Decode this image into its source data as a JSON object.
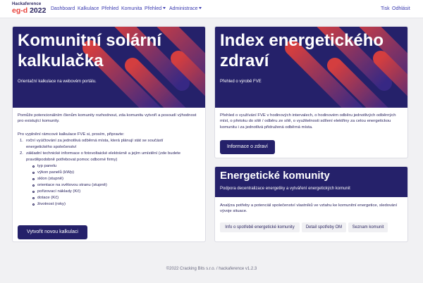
{
  "logo": {
    "line1": "Hackaference",
    "line2_red": "eg-d",
    "line2_dark": " 2022"
  },
  "nav": {
    "dashboard": "Dashboard",
    "kalkulace": "Kalkulace",
    "prehled": "Přehled",
    "komunita": "Komunita",
    "prehled_dropdown": "Přehled",
    "administrace": "Administrace",
    "tisk": "Tisk",
    "odhlasit": "Odhlásit"
  },
  "calc_card": {
    "title_line1": "Komunitní solární",
    "title_line2": "kalkulačka",
    "subtitle": "Orientační kalkulace na webovém portálu.",
    "intro": "Pomůže potencionálním členům komunity rozhodnout, zda komunitu vytvoří a posoudí výhodnost pro existující komunity.",
    "prep": "Pro vyplnění rámcové kalkulace FVE si, prosím, připravte:",
    "items": [
      {
        "num": "1.",
        "line1": "roční vyúčtování za jednotlivá odběrná místa, která plánují stát se součástí",
        "line2": "energetického společenství"
      },
      {
        "num": "2.",
        "line1": "základní technické informace o fotovoltaické elektrárně a jejím umístění (zde budete",
        "line2": "pravděpodobně potřebovat pomoc odborné firmy)"
      }
    ],
    "bullets": [
      "typ panelu",
      "výkon panelů (kWp)",
      "sklon (stupně)",
      "orientace na světovou stranu (stupně)",
      "pořizovací náklady (Kč)",
      "dotace (Kč)",
      "životnost (roky)"
    ],
    "button": "Vytvořit novou kalkulaci"
  },
  "health_card": {
    "title_line1": "Index energetického",
    "title_line2": "zdraví",
    "subtitle": "Přehled o výrobě FVE",
    "text": "Přehled o využívání FVE v hodinových intervalech, o hodinovém odběru jednotlivých odběrných míst, o přetoku do sítě / odběru ze sítě, o využitelnosti sdílení elektřiny za celou energetickou komunitu i za jednotlivá přidružená odběrná místa.",
    "button": "Informace o zdraví"
  },
  "community_card": {
    "title": "Energetické komunity",
    "subtitle": "Podpora decentralizace energetiky a vytváření energetických komunit",
    "text": "Analýza potřeby a potenciál společenství vlastníků ve vztahu ke komunitní energetice, sledování vývoje situace.",
    "pills": [
      "Info o spotřebě energetické komunity",
      "Detail spotřeby OM",
      "Seznam komunit"
    ]
  },
  "footer": "©2022 Cracking Bits s.r.o. / hackaference v1.2.3",
  "colors": {
    "primary": "#25216a",
    "accent": "#e8423b",
    "link": "#3a3ab0",
    "background": "#f1f1f3"
  }
}
